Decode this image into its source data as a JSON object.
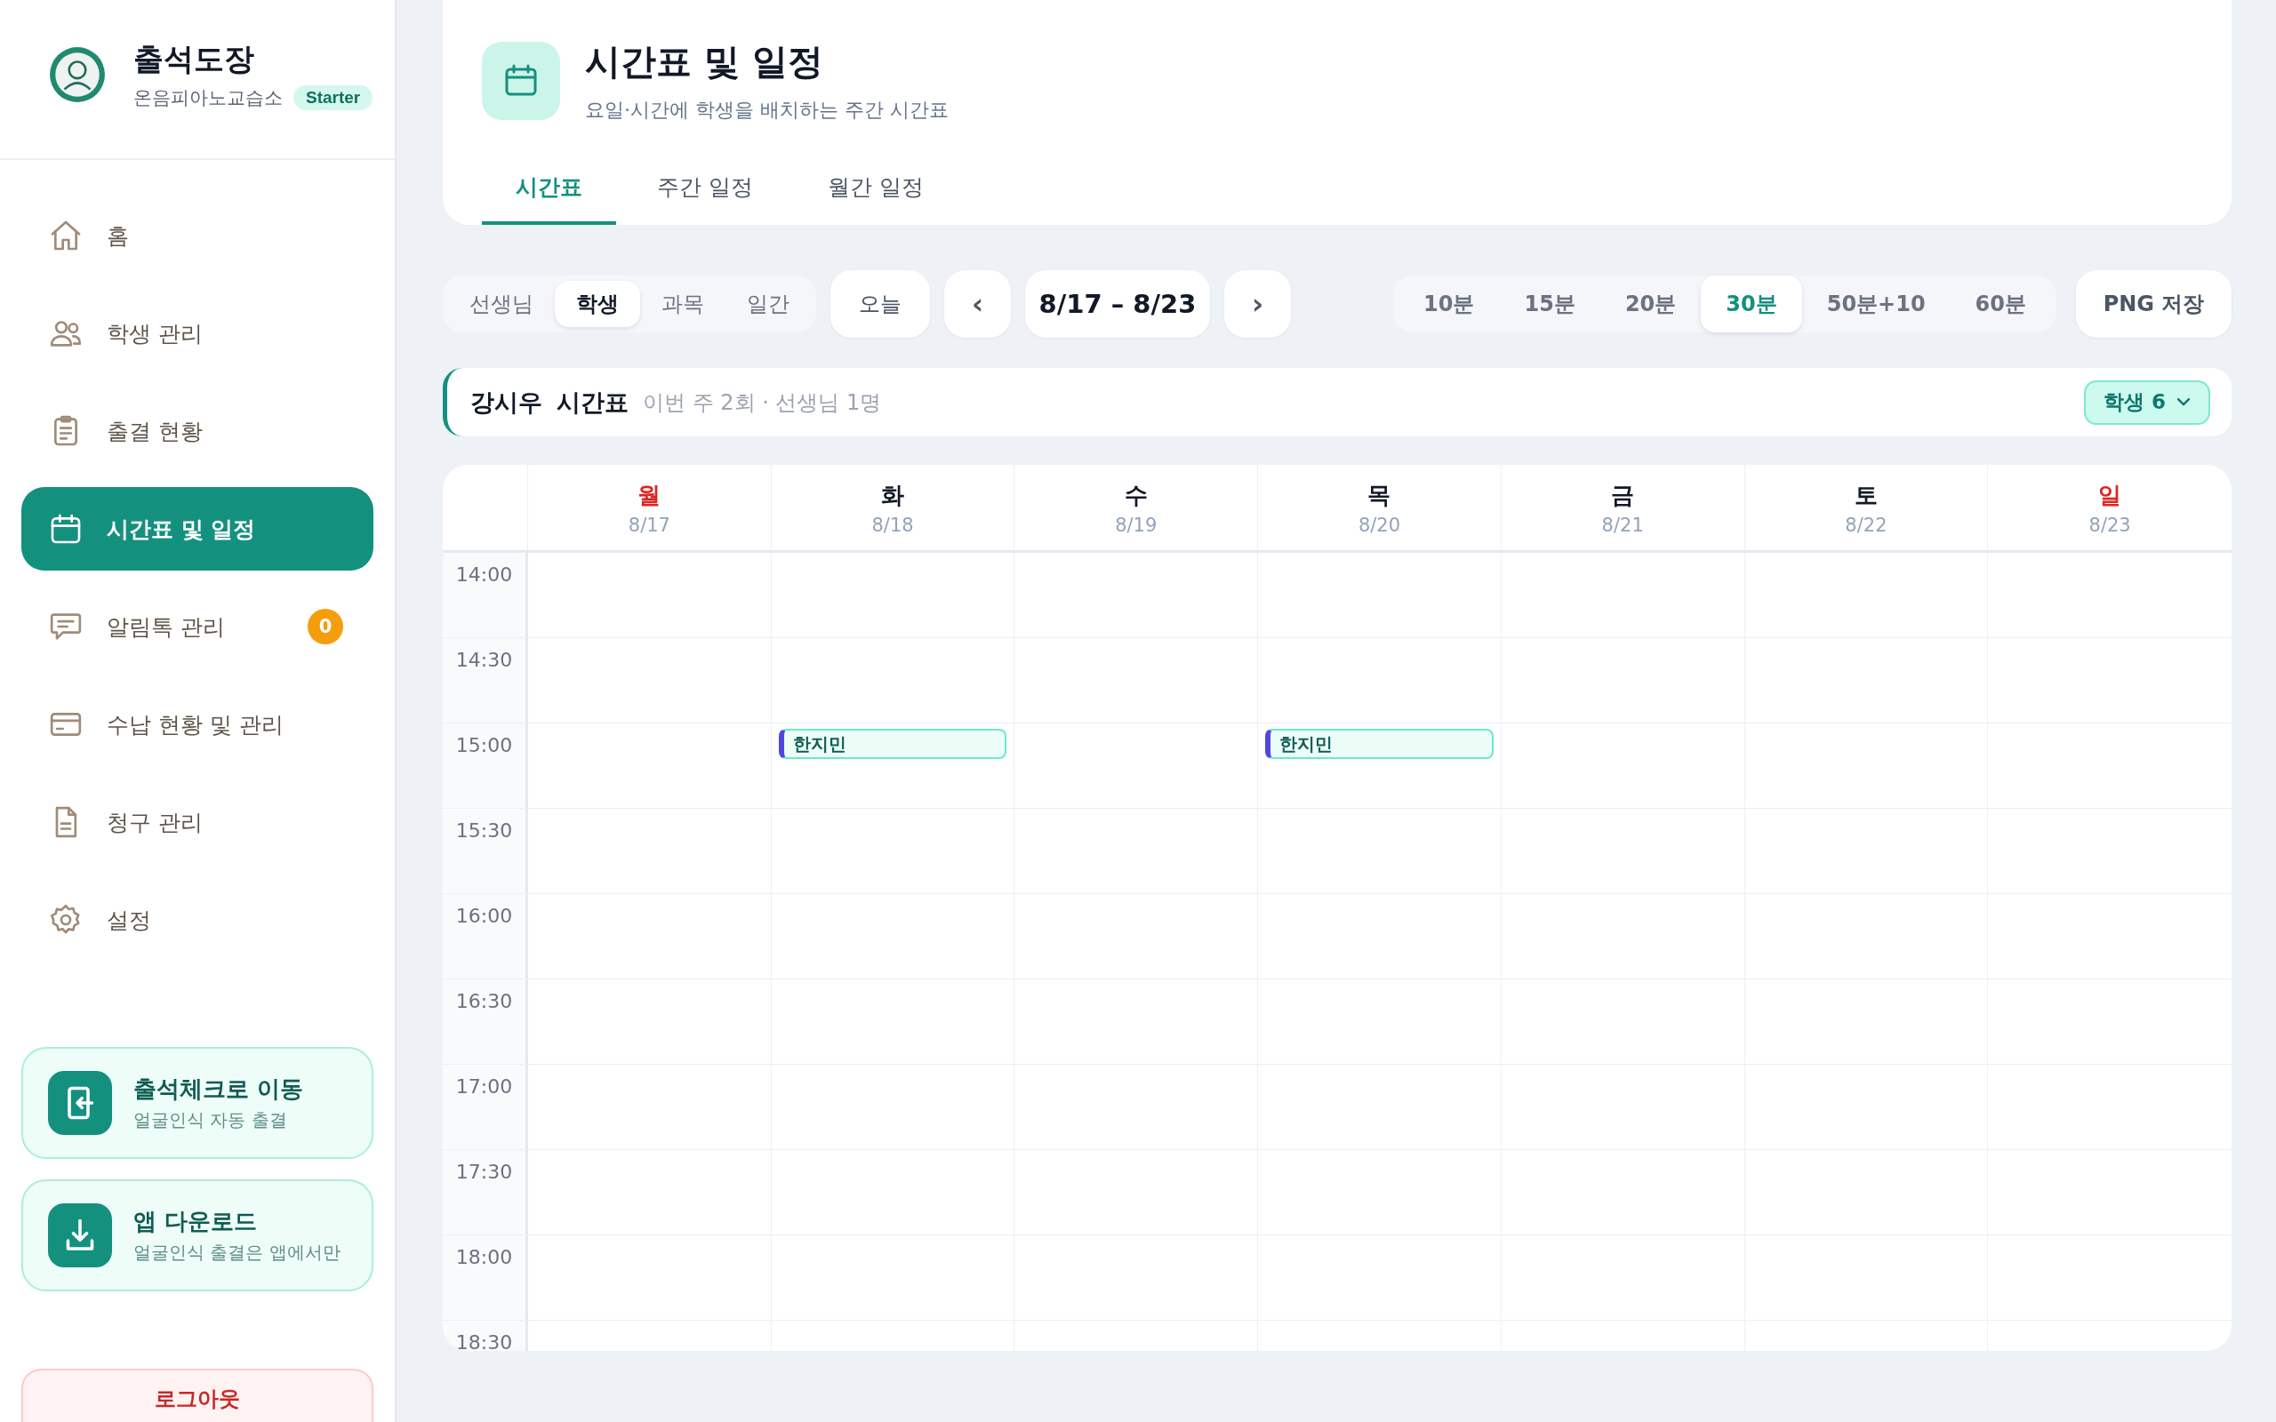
{
  "sidebar": {
    "brand": {
      "name": "출석도장",
      "org": "온음피아노교습소",
      "plan": "Starter"
    },
    "nav": [
      {
        "label": "홈",
        "kind": "home",
        "selected": false
      },
      {
        "label": "학생 관리",
        "kind": "people",
        "selected": false
      },
      {
        "label": "출결 현황",
        "kind": "clipboard",
        "selected": false
      },
      {
        "label": "시간표 및 일정",
        "kind": "calendar",
        "selected": true
      },
      {
        "label": "알림톡 관리",
        "kind": "chat",
        "selected": false,
        "badge": "0"
      },
      {
        "label": "수납 현황 및 관리",
        "kind": "card",
        "selected": false
      },
      {
        "label": "청구 관리",
        "kind": "document",
        "selected": false
      },
      {
        "label": "설정",
        "kind": "gear",
        "selected": false
      }
    ],
    "promos": [
      {
        "kind": "enter",
        "title": "출석체크로 이동",
        "subtitle": "얼굴인식 자동 출결"
      },
      {
        "kind": "download",
        "title": "앱 다운로드",
        "subtitle": "얼굴인식 출결은 앱에서만"
      }
    ],
    "logout": "로그아웃"
  },
  "header": {
    "title": "시간표 및 일정",
    "subtitle": "요일·시간에 학생을 배치하는 주간 시간표",
    "tabs": [
      {
        "label": "시간표",
        "selected": true
      },
      {
        "label": "주간 일정",
        "selected": false
      },
      {
        "label": "월간 일정",
        "selected": false
      }
    ]
  },
  "toolbar": {
    "view_modes": [
      {
        "label": "선생님",
        "selected": false
      },
      {
        "label": "학생",
        "selected": true
      },
      {
        "label": "과목",
        "selected": false
      },
      {
        "label": "일간",
        "selected": false
      }
    ],
    "today": "오늘",
    "prev": "‹",
    "range": "8/17 – 8/23",
    "next": "›",
    "intervals": [
      {
        "label": "10분",
        "selected": false
      },
      {
        "label": "15분",
        "selected": false
      },
      {
        "label": "20분",
        "selected": false
      },
      {
        "label": "30분",
        "selected": true
      },
      {
        "label": "50분+10",
        "selected": false
      },
      {
        "label": "60분",
        "selected": false
      }
    ],
    "export": "PNG 저장"
  },
  "schedule_bar": {
    "name": "강시우",
    "title": "시간표",
    "summary": "이번 주 2회 · 선생님 1명",
    "filter": "학생 6"
  },
  "calendar": {
    "days": [
      {
        "day": "월",
        "date": "8/17",
        "color": "#dc2626"
      },
      {
        "day": "화",
        "date": "8/18",
        "color": "#111827"
      },
      {
        "day": "수",
        "date": "8/19",
        "color": "#111827"
      },
      {
        "day": "목",
        "date": "8/20",
        "color": "#111827"
      },
      {
        "day": "금",
        "date": "8/21",
        "color": "#111827"
      },
      {
        "day": "토",
        "date": "8/22",
        "color": "#111827"
      },
      {
        "day": "일",
        "date": "8/23",
        "color": "#dc2626"
      }
    ],
    "rows": [
      {
        "time": "14:00"
      },
      {
        "time": "14:30"
      },
      {
        "time": "15:00",
        "cells": [
          null,
          {
            "name": "한지민"
          },
          null,
          {
            "name": "한지민"
          },
          null,
          null,
          null
        ]
      },
      {
        "time": "15:30"
      },
      {
        "time": "16:00"
      },
      {
        "time": "16:30"
      },
      {
        "time": "17:00"
      },
      {
        "time": "17:30"
      },
      {
        "time": "18:00"
      },
      {
        "time": "18:30"
      }
    ]
  }
}
